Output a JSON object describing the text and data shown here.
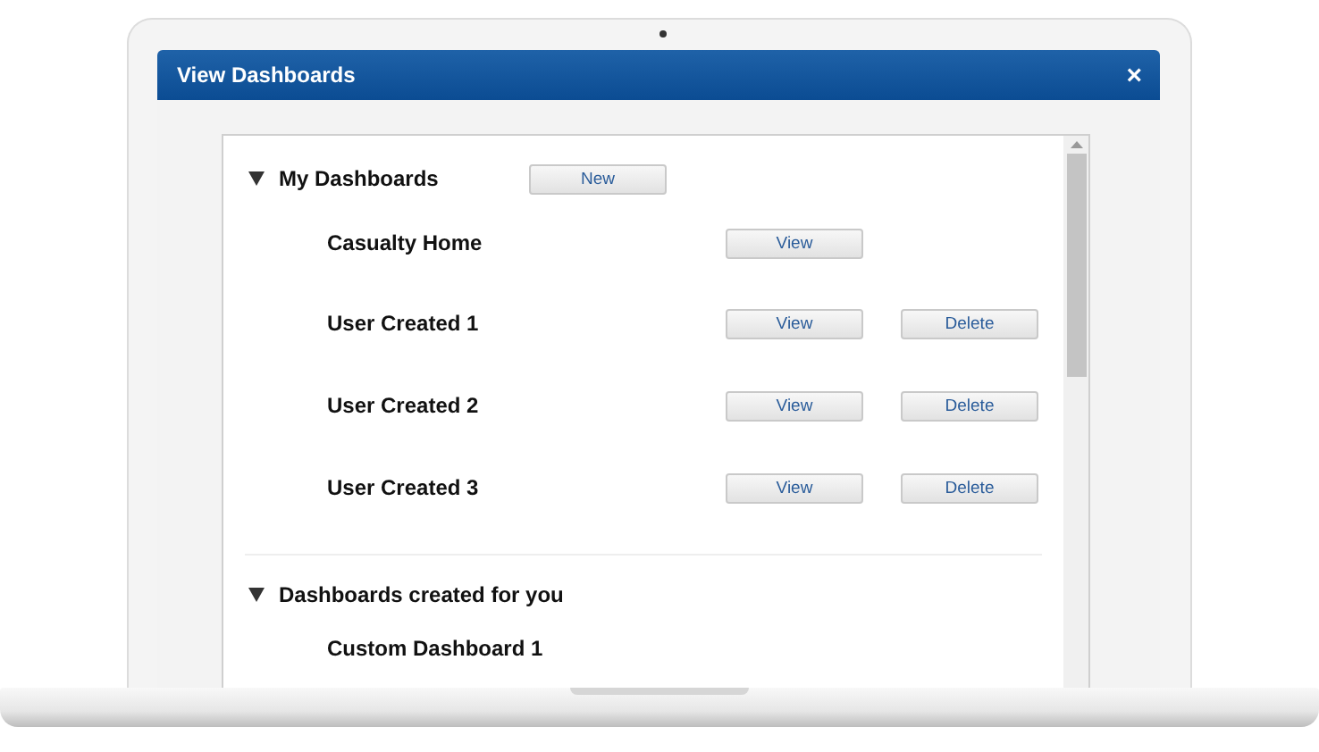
{
  "dialog": {
    "title": "View Dashboards",
    "close": "×"
  },
  "sections": [
    {
      "title": "My Dashboards",
      "expanded": true,
      "button": "New",
      "items": [
        {
          "name": "Casualty Home",
          "buttons": [
            "View"
          ]
        },
        {
          "name": "User Created 1",
          "buttons": [
            "View",
            "Delete"
          ]
        },
        {
          "name": "User Created 2",
          "buttons": [
            "View",
            "Delete"
          ]
        },
        {
          "name": "User Created 3",
          "buttons": [
            "View",
            "Delete"
          ]
        }
      ]
    },
    {
      "title": "Dashboards created for you",
      "expanded": true,
      "items": [
        {
          "name": "Custom Dashboard 1"
        }
      ]
    }
  ]
}
